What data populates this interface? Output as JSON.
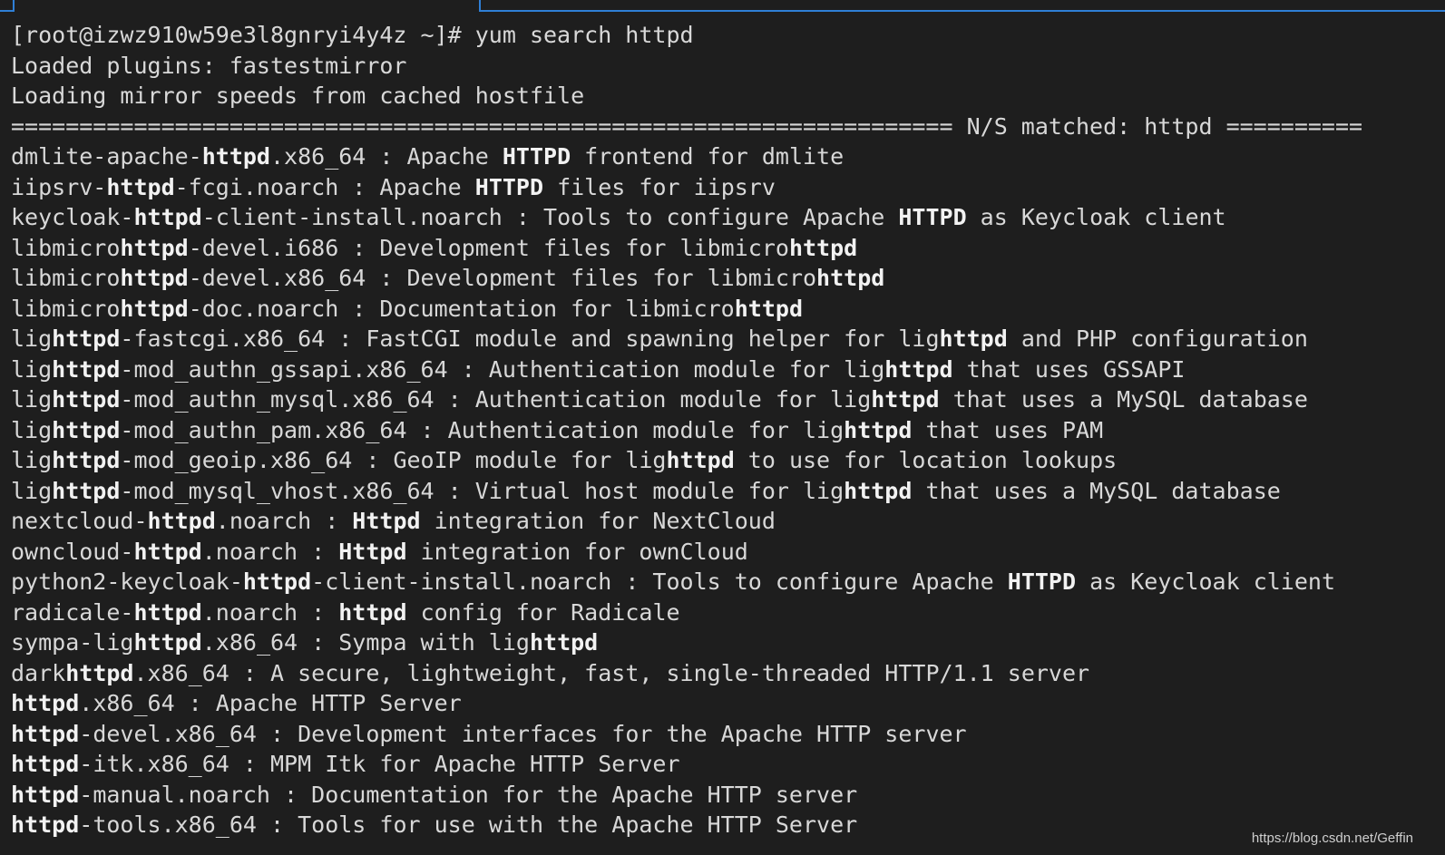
{
  "terminal": {
    "lines": [
      [
        {
          "t": "[root@izwz910w59e3l8gnryi4y4z ~]# yum search httpd"
        }
      ],
      [
        {
          "t": "Loaded plugins: fastestmirror"
        }
      ],
      [
        {
          "t": "Loading mirror speeds from cached hostfile"
        }
      ],
      [
        {
          "t": "===================================================================== N/S matched: httpd =========="
        }
      ],
      [
        {
          "t": "dmlite-apache-"
        },
        {
          "t": "httpd",
          "b": true
        },
        {
          "t": ".x86_64 : Apache "
        },
        {
          "t": "HTTPD",
          "b": true
        },
        {
          "t": " frontend for dmlite"
        }
      ],
      [
        {
          "t": "iipsrv-"
        },
        {
          "t": "httpd",
          "b": true
        },
        {
          "t": "-fcgi.noarch : Apache "
        },
        {
          "t": "HTTPD",
          "b": true
        },
        {
          "t": " files for iipsrv"
        }
      ],
      [
        {
          "t": "keycloak-"
        },
        {
          "t": "httpd",
          "b": true
        },
        {
          "t": "-client-install.noarch : Tools to configure Apache "
        },
        {
          "t": "HTTPD",
          "b": true
        },
        {
          "t": " as Keycloak client"
        }
      ],
      [
        {
          "t": "libmicro"
        },
        {
          "t": "httpd",
          "b": true
        },
        {
          "t": "-devel.i686 : Development files for libmicro"
        },
        {
          "t": "httpd",
          "b": true
        }
      ],
      [
        {
          "t": "libmicro"
        },
        {
          "t": "httpd",
          "b": true
        },
        {
          "t": "-devel.x86_64 : Development files for libmicro"
        },
        {
          "t": "httpd",
          "b": true
        }
      ],
      [
        {
          "t": "libmicro"
        },
        {
          "t": "httpd",
          "b": true
        },
        {
          "t": "-doc.noarch : Documentation for libmicro"
        },
        {
          "t": "httpd",
          "b": true
        }
      ],
      [
        {
          "t": "lig"
        },
        {
          "t": "httpd",
          "b": true
        },
        {
          "t": "-fastcgi.x86_64 : FastCGI module and spawning helper for lig"
        },
        {
          "t": "httpd",
          "b": true
        },
        {
          "t": " and PHP configuration"
        }
      ],
      [
        {
          "t": "lig"
        },
        {
          "t": "httpd",
          "b": true
        },
        {
          "t": "-mod_authn_gssapi.x86_64 : Authentication module for lig"
        },
        {
          "t": "httpd",
          "b": true
        },
        {
          "t": " that uses GSSAPI"
        }
      ],
      [
        {
          "t": "lig"
        },
        {
          "t": "httpd",
          "b": true
        },
        {
          "t": "-mod_authn_mysql.x86_64 : Authentication module for lig"
        },
        {
          "t": "httpd",
          "b": true
        },
        {
          "t": " that uses a MySQL database"
        }
      ],
      [
        {
          "t": "lig"
        },
        {
          "t": "httpd",
          "b": true
        },
        {
          "t": "-mod_authn_pam.x86_64 : Authentication module for lig"
        },
        {
          "t": "httpd",
          "b": true
        },
        {
          "t": " that uses PAM"
        }
      ],
      [
        {
          "t": "lig"
        },
        {
          "t": "httpd",
          "b": true
        },
        {
          "t": "-mod_geoip.x86_64 : GeoIP module for lig"
        },
        {
          "t": "httpd",
          "b": true
        },
        {
          "t": " to use for location lookups"
        }
      ],
      [
        {
          "t": "lig"
        },
        {
          "t": "httpd",
          "b": true
        },
        {
          "t": "-mod_mysql_vhost.x86_64 : Virtual host module for lig"
        },
        {
          "t": "httpd",
          "b": true
        },
        {
          "t": " that uses a MySQL database"
        }
      ],
      [
        {
          "t": "nextcloud-"
        },
        {
          "t": "httpd",
          "b": true
        },
        {
          "t": ".noarch : "
        },
        {
          "t": "Httpd",
          "b": true
        },
        {
          "t": " integration for NextCloud"
        }
      ],
      [
        {
          "t": "owncloud-"
        },
        {
          "t": "httpd",
          "b": true
        },
        {
          "t": ".noarch : "
        },
        {
          "t": "Httpd",
          "b": true
        },
        {
          "t": " integration for ownCloud"
        }
      ],
      [
        {
          "t": "python2-keycloak-"
        },
        {
          "t": "httpd",
          "b": true
        },
        {
          "t": "-client-install.noarch : Tools to configure Apache "
        },
        {
          "t": "HTTPD",
          "b": true
        },
        {
          "t": " as Keycloak client"
        }
      ],
      [
        {
          "t": "radicale-"
        },
        {
          "t": "httpd",
          "b": true
        },
        {
          "t": ".noarch : "
        },
        {
          "t": "httpd",
          "b": true
        },
        {
          "t": " config for Radicale"
        }
      ],
      [
        {
          "t": "sympa-lig"
        },
        {
          "t": "httpd",
          "b": true
        },
        {
          "t": ".x86_64 : Sympa with lig"
        },
        {
          "t": "httpd",
          "b": true
        }
      ],
      [
        {
          "t": "dark"
        },
        {
          "t": "httpd",
          "b": true
        },
        {
          "t": ".x86_64 : A secure, lightweight, fast, single-threaded HTTP/1.1 server"
        }
      ],
      [
        {
          "t": "httpd",
          "b": true
        },
        {
          "t": ".x86_64 : Apache HTTP Server"
        }
      ],
      [
        {
          "t": "httpd",
          "b": true
        },
        {
          "t": "-devel.x86_64 : Development interfaces for the Apache HTTP server"
        }
      ],
      [
        {
          "t": "httpd",
          "b": true
        },
        {
          "t": "-itk.x86_64 : MPM Itk for Apache HTTP Server"
        }
      ],
      [
        {
          "t": "httpd",
          "b": true
        },
        {
          "t": "-manual.noarch : Documentation for the Apache HTTP server"
        }
      ],
      [
        {
          "t": "httpd",
          "b": true
        },
        {
          "t": "-tools.x86_64 : Tools for use with the Apache HTTP Server"
        }
      ]
    ]
  },
  "watermark": "https://blog.csdn.net/Geffin",
  "colors": {
    "background": "#1e1e1e",
    "text": "#d8d8d8",
    "bold_text": "#f2f2f2",
    "tab_border": "#2f7fd6"
  }
}
